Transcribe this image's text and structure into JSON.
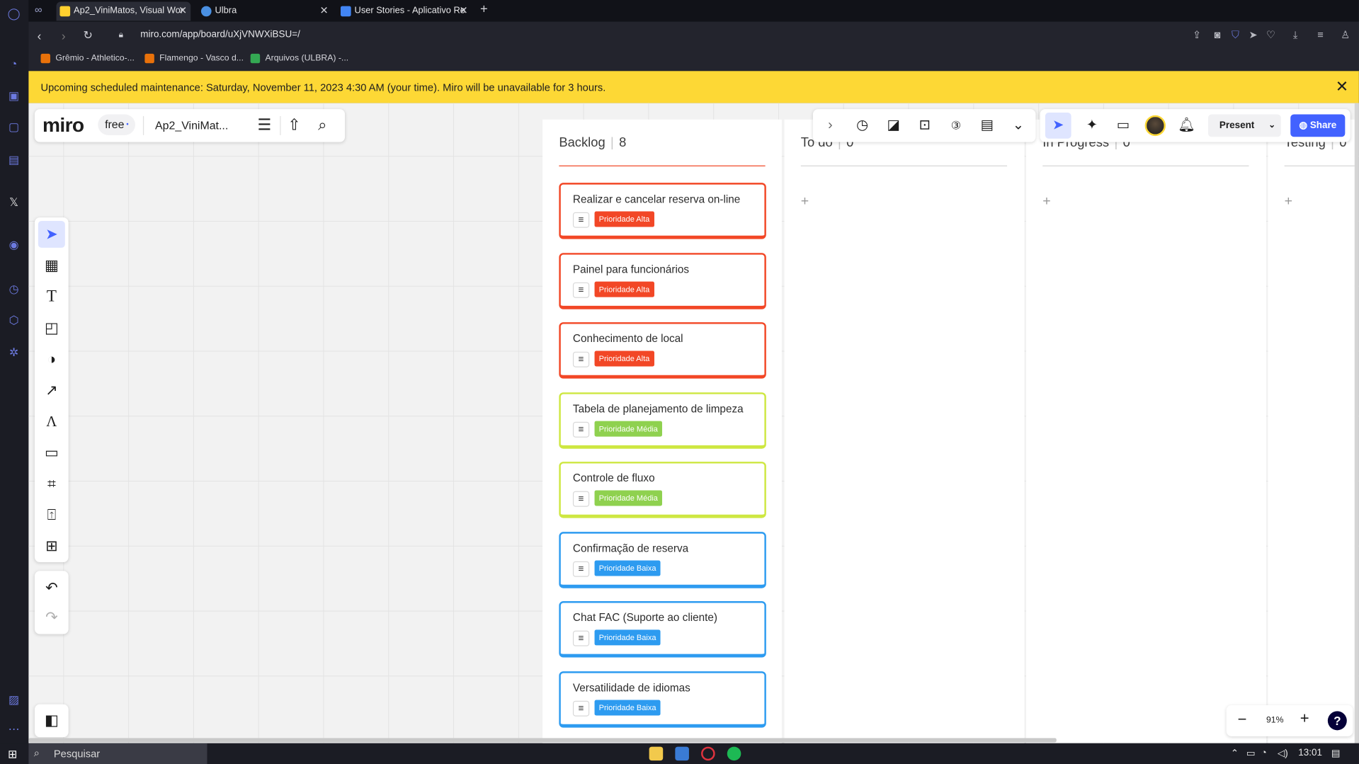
{
  "browser": {
    "tabs": [
      {
        "title": "Ap2_ViniMatos, Visual Wor",
        "active": true,
        "favicon_color": "#ffd02f"
      },
      {
        "title": "Ulbra",
        "active": false,
        "favicon_color": "#4a90e2"
      },
      {
        "title": "User Stories - Aplicativo Re",
        "active": false,
        "favicon_color": "#4285f4"
      }
    ],
    "url": "miro.com/app/board/uXjVNWXiBSU=/",
    "bookmarks": [
      {
        "label": "Grêmio - Athletico-...",
        "color": "#e8710a"
      },
      {
        "label": "Flamengo - Vasco d...",
        "color": "#e8710a"
      },
      {
        "label": "Arquivos (ULBRA) -...",
        "color": "#34a853"
      }
    ]
  },
  "banner": {
    "text": "Upcoming scheduled maintenance: Saturday, November 11, 2023 4:30 AM (your time). Miro will be unavailable for 3 hours."
  },
  "brand": {
    "logo": "miro",
    "plan": "free",
    "board_name": "Ap2_ViniMat..."
  },
  "toolbar": {
    "present_label": "Present",
    "share_label": "Share"
  },
  "columns": [
    {
      "name": "Backlog",
      "count": "8"
    },
    {
      "name": "To do",
      "count": "0"
    },
    {
      "name": "In Progress",
      "count": "0"
    },
    {
      "name": "Testing",
      "count": "0"
    }
  ],
  "cards": [
    {
      "title": "Realizar e cancelar reserva on-line",
      "tag": "Prioridade Alta",
      "level": "hi"
    },
    {
      "title": "Painel para funcionários",
      "tag": "Prioridade Alta",
      "level": "hi"
    },
    {
      "title": "Conhecimento de local",
      "tag": "Prioridade Alta",
      "level": "hi"
    },
    {
      "title": "Tabela de planejamento de limpeza",
      "tag": "Prioridade Média",
      "level": "mid"
    },
    {
      "title": "Controle de fluxo",
      "tag": "Prioridade Média",
      "level": "mid"
    },
    {
      "title": "Confirmação de reserva",
      "tag": "Prioridade Baixa",
      "level": "lo"
    },
    {
      "title": "Chat FAC (Suporte ao cliente)",
      "tag": "Prioridade Baixa",
      "level": "lo"
    },
    {
      "title": "Versatilidade de idiomas",
      "tag": "Prioridade Baixa",
      "level": "lo"
    }
  ],
  "zoom": {
    "value": "91%"
  },
  "taskbar": {
    "search_placeholder": "Pesquisar",
    "time": "13:01"
  },
  "colors": {
    "accent": "#4262ff",
    "banner": "#fdd835",
    "high": "#f24726",
    "medium": "#8fd14f",
    "low": "#2d9bf0"
  }
}
